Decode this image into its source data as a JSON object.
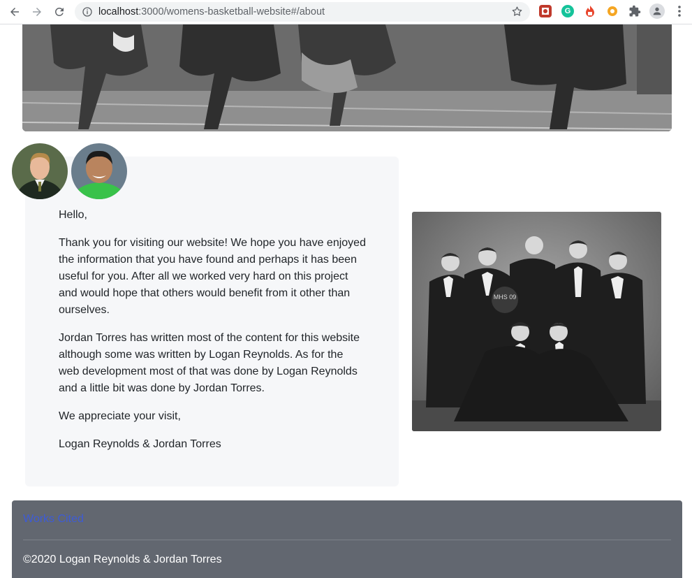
{
  "browser": {
    "url_host": "localhost",
    "url_path": ":3000/womens-basketball-website#/about",
    "icons": {
      "back": "arrow-left-icon",
      "forward": "arrow-right-icon",
      "reload": "reload-icon",
      "info": "info-icon",
      "bookmark": "star-icon",
      "extensions": "puzzle-icon",
      "profile": "person-icon",
      "menu": "kebab-menu-icon"
    }
  },
  "page": {
    "hero_alt": "historic women's basketball team photo",
    "authors": [
      "Logan Reynolds",
      "Jordan Torres"
    ],
    "letter": {
      "greeting": "Hello,",
      "paragraph_1": "Thank you for visiting our website! We hope you have enjoyed the information that you have found and perhaps it has been useful for you. After all we worked very hard on this project and would hope that others would benefit from it other than ourselves.",
      "paragraph_2": "Jordan Torres has written most of the content for this website although some was written by Logan Reynolds. As for the web development most of that was done by Logan Reynolds and a little bit was done by Jordan Torres.",
      "closing": "We appreciate your visit,",
      "signature": "Logan Reynolds & Jordan Torres"
    },
    "team_photo_ball_text": "MHS 09"
  },
  "footer": {
    "link": "Works Cited",
    "copyright": "©2020 Logan Reynolds & Jordan Torres"
  },
  "colors": {
    "footer_bg": "#626770",
    "link": "#3d5bd6",
    "card_bg": "#f6f7f9"
  }
}
